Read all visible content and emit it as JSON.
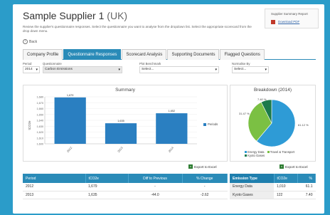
{
  "header": {
    "title": "Sample Supplier 1",
    "region": "(UK)",
    "description": "Review the supplier's questionnaire responses. Select the questionnaire you want to analyse from the dropdown list. Select the appropriate scorecard from the drop down menu.",
    "back_label": "Back"
  },
  "report": {
    "title": "Supplier Summary Report",
    "download_label": "Download PDF"
  },
  "tabs": [
    {
      "label": "Company Profile"
    },
    {
      "label": "Questionnaire Responses"
    },
    {
      "label": "Scorecard Analysis"
    },
    {
      "label": "Supporting Documents"
    },
    {
      "label": "Flagged Questions"
    }
  ],
  "filters": {
    "period": {
      "label": "Period",
      "value": "2014"
    },
    "questionnaire": {
      "label": "Questionnaire",
      "value": "Carbon Emissions"
    },
    "benchmark": {
      "label": "Plot Benchmark",
      "value": "Select..."
    },
    "normalise": {
      "label": "Normalise By",
      "value": "Select..."
    }
  },
  "export_label": "Export to Excel",
  "summary_chart": {
    "title": "Summary",
    "ylabel": "tCO2e",
    "legend": "Periods",
    "categories": [
      "2012",
      "2013",
      "2014"
    ],
    "values": [
      1679,
      1635,
      1652
    ],
    "value_labels": [
      "1,679",
      "1,635",
      "1,652"
    ],
    "yticks": [
      "1,680",
      "1,670",
      "1,660",
      "1,650",
      "1,640",
      "1,630",
      "1,620",
      "1,610",
      "1,600"
    ],
    "ylim": [
      1600,
      1680
    ]
  },
  "breakdown_chart": {
    "title": "Breakdown (2014)",
    "slices": [
      {
        "name": "Energy Data",
        "value": 61.1,
        "label": "61.12 %",
        "color": "#2e9bd6"
      },
      {
        "name": "Travel & Transport",
        "value": 31.4,
        "label": "31.47 %",
        "color": "#7bc043"
      },
      {
        "name": "Kyoto Gases",
        "value": 7.4,
        "label": "7.40 %",
        "color": "#1b7a4b"
      }
    ]
  },
  "summary_table": {
    "headers": [
      "Period",
      "tCO2e",
      "Diff to Previous",
      "% Change"
    ],
    "rows": [
      [
        "2012",
        "1,679",
        "-",
        "-"
      ],
      [
        "2013",
        "1,635",
        "-44.0",
        "-2.62"
      ]
    ]
  },
  "breakdown_table": {
    "headers": [
      "Emission Type",
      "tCO2e",
      "%"
    ],
    "rows": [
      [
        "Energy Data",
        "1,010",
        "61.1"
      ],
      [
        "Kyoto Gases",
        "122",
        "7.40"
      ]
    ]
  },
  "chart_data": [
    {
      "type": "bar",
      "title": "Summary",
      "xlabel": "",
      "ylabel": "tCO2e",
      "categories": [
        "2012",
        "2013",
        "2014"
      ],
      "series": [
        {
          "name": "Periods",
          "values": [
            1679,
            1635,
            1652
          ]
        }
      ],
      "ylim": [
        1600,
        1680
      ]
    },
    {
      "type": "pie",
      "title": "Breakdown (2014)",
      "categories": [
        "Energy Data",
        "Travel & Transport",
        "Kyoto Gases"
      ],
      "values": [
        61.12,
        31.47,
        7.4
      ]
    }
  ]
}
